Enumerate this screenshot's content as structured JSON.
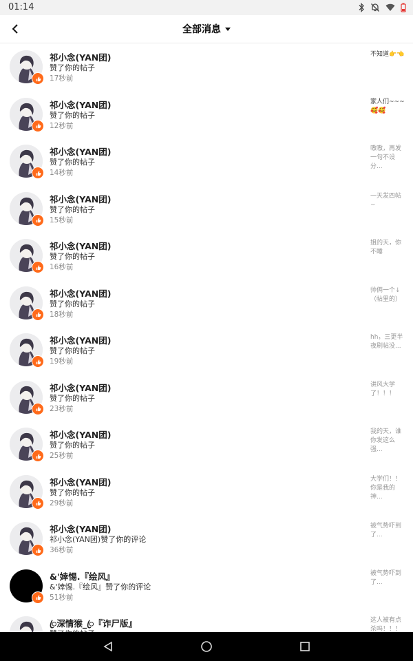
{
  "status_bar": {
    "time": "01:14",
    "icons": [
      "bluetooth-icon",
      "notifications-off-icon",
      "wifi-icon",
      "battery-low-icon"
    ],
    "battery_color": "#e53935"
  },
  "header": {
    "title": "全部消息"
  },
  "colors": {
    "badge": "#ff6a1a"
  },
  "messages": [
    {
      "name": "祁小念(YAN团)",
      "action": "赞了你的帖子",
      "time": "17秒前",
      "preview": "不知道👉👈",
      "avatar": "illustrated"
    },
    {
      "name": "祁小念(YAN团)",
      "action": "赞了你的帖子",
      "time": "12秒前",
      "preview": "家人们~~~🥰🥰",
      "avatar": "illustrated"
    },
    {
      "name": "祁小念(YAN团)",
      "action": "赞了你的帖子",
      "time": "14秒前",
      "preview": "嗷嗷，再发一句不设分...",
      "avatar": "illustrated"
    },
    {
      "name": "祁小念(YAN团)",
      "action": "赞了你的帖子",
      "time": "15秒前",
      "preview": "一天发四帖~",
      "avatar": "illustrated"
    },
    {
      "name": "祁小念(YAN团)",
      "action": "赞了你的帖子",
      "time": "16秒前",
      "preview": "姐的天，你不睡",
      "avatar": "illustrated"
    },
    {
      "name": "祁小念(YAN团)",
      "action": "赞了你的帖子",
      "time": "18秒前",
      "preview": "帅俩一个↓（帖里的）",
      "avatar": "illustrated"
    },
    {
      "name": "祁小念(YAN团)",
      "action": "赞了你的帖子",
      "time": "19秒前",
      "preview": "hh，三更半夜刷帖没...",
      "avatar": "illustrated"
    },
    {
      "name": "祁小念(YAN团)",
      "action": "赞了你的帖子",
      "time": "23秒前",
      "preview": "讲风大学了！！！",
      "avatar": "illustrated"
    },
    {
      "name": "祁小念(YAN团)",
      "action": "赞了你的帖子",
      "time": "25秒前",
      "preview": "我的天，谁你发这么强...",
      "avatar": "illustrated"
    },
    {
      "name": "祁小念(YAN团)",
      "action": "赞了你的帖子",
      "time": "29秒前",
      "preview": "大学们！！你是我的神...",
      "avatar": "illustrated"
    },
    {
      "name": "祁小念(YAN团)",
      "action": "祁小念(YAN团)赞了你的评论",
      "time": "36秒前",
      "preview": "被气势吓到了...",
      "avatar": "illustrated"
    },
    {
      "name": "&'婞惕.『绘风』",
      "action": "&'婞惕.『绘风』赞了你的评论",
      "time": "51秒前",
      "preview": "被气势吓到了...",
      "avatar": "black"
    },
    {
      "name": "ꦿ深情猴_ꦿ『诈尸版』",
      "action": "赞了你的帖子",
      "time": "",
      "preview": "这人被有点杀吗！！！",
      "avatar": "illustrated"
    }
  ],
  "nav": {
    "buttons": [
      "back-triangle-icon",
      "home-circle-icon",
      "recents-square-icon"
    ]
  }
}
